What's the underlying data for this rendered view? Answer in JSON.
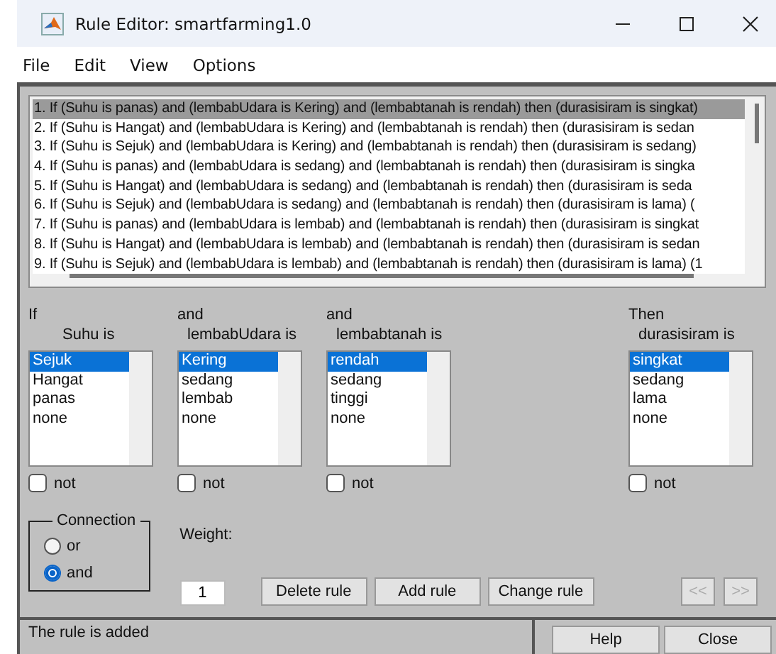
{
  "window": {
    "title": "Rule Editor: smartfarming1.0"
  },
  "menu": [
    "File",
    "Edit",
    "View",
    "Options"
  ],
  "rules": [
    {
      "text": "1. If (Suhu is panas) and (lembabUdara is Kering) and (lembabtanah is rendah) then (durasisiram is singkat)",
      "selected": true
    },
    {
      "text": "2. If (Suhu is Hangat) and (lembabUdara is Kering) and (lembabtanah is rendah) then (durasisiram is sedan",
      "selected": false
    },
    {
      "text": "3. If (Suhu is Sejuk) and (lembabUdara is Kering) and (lembabtanah is rendah) then (durasisiram is sedang)",
      "selected": false
    },
    {
      "text": "4. If (Suhu is panas) and (lembabUdara is sedang) and (lembabtanah is rendah) then (durasisiram is singka",
      "selected": false
    },
    {
      "text": "5. If (Suhu is Hangat) and (lembabUdara is sedang) and (lembabtanah is rendah) then (durasisiram is seda",
      "selected": false
    },
    {
      "text": "6. If (Suhu is Sejuk) and (lembabUdara is sedang) and (lembabtanah is rendah) then (durasisiram is lama) (",
      "selected": false
    },
    {
      "text": "7. If (Suhu is panas) and (lembabUdara is lembab) and (lembabtanah is rendah) then (durasisiram is singkat",
      "selected": false
    },
    {
      "text": "8. If (Suhu is Hangat) and (lembabUdara is lembab) and (lembabtanah is rendah) then (durasisiram is sedan",
      "selected": false
    },
    {
      "text": "9. If (Suhu is Sejuk) and (lembabUdara is lembab) and (lembabtanah is rendah) then (durasisiram is lama) (1",
      "selected": false
    }
  ],
  "columns": [
    {
      "kind": "antecedent",
      "connector": "If",
      "variable": "Suhu is",
      "not": false,
      "not_label": "not",
      "options": [
        {
          "label": "Sejuk",
          "selected": true
        },
        {
          "label": "Hangat",
          "selected": false
        },
        {
          "label": "panas",
          "selected": false
        },
        {
          "label": "none",
          "selected": false
        }
      ]
    },
    {
      "kind": "antecedent",
      "connector": "and",
      "variable": "lembabUdara is",
      "not": false,
      "not_label": "not",
      "options": [
        {
          "label": "Kering",
          "selected": true
        },
        {
          "label": "sedang",
          "selected": false
        },
        {
          "label": "lembab",
          "selected": false
        },
        {
          "label": "none",
          "selected": false
        }
      ]
    },
    {
      "kind": "antecedent",
      "connector": "and",
      "variable": "lembabtanah is",
      "not": false,
      "not_label": "not",
      "options": [
        {
          "label": "rendah",
          "selected": true
        },
        {
          "label": "sedang",
          "selected": false
        },
        {
          "label": "tinggi",
          "selected": false
        },
        {
          "label": "none",
          "selected": false
        }
      ]
    },
    {
      "kind": "consequent",
      "connector": "Then",
      "variable": "durasisiram is",
      "not": false,
      "not_label": "not",
      "options": [
        {
          "label": "singkat",
          "selected": true
        },
        {
          "label": "sedang",
          "selected": false
        },
        {
          "label": "lama",
          "selected": false
        },
        {
          "label": "none",
          "selected": false
        }
      ]
    }
  ],
  "connection": {
    "label": "Connection",
    "options": [
      {
        "label": "or",
        "selected": false
      },
      {
        "label": "and",
        "selected": true
      }
    ]
  },
  "weight": {
    "label": "Weight:",
    "value": "1"
  },
  "buttons": [
    {
      "label": "Delete rule",
      "disabled": false
    },
    {
      "label": "Add rule",
      "disabled": false
    },
    {
      "label": "Change rule",
      "disabled": false
    }
  ],
  "nav_buttons": [
    {
      "label": "<<",
      "disabled": true
    },
    {
      "label": ">>",
      "disabled": true
    }
  ],
  "status": "The rule is added",
  "footer_buttons": [
    "Help",
    "Close"
  ]
}
